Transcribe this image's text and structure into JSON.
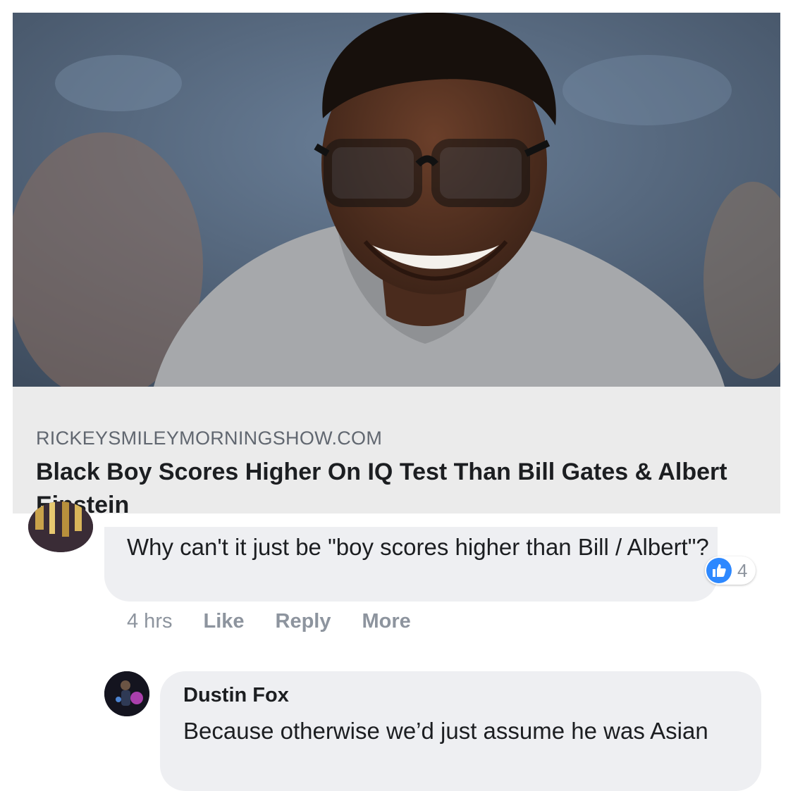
{
  "link_preview": {
    "image_icon": "photo-of-smiling-student-with-glasses",
    "domain": "RICKEYSMILEYMORNINGSHOW.COM",
    "title": "Black Boy Scores Higher On IQ Test Than Bill Gates & Albert Einstein"
  },
  "comment": {
    "avatar_icon": "user-avatar",
    "text": "Why can't it just be \"boy scores higher than Bill / Albert\"?",
    "like_icon": "thumbs-up-icon",
    "like_count": "4",
    "actions": {
      "time": "4 hrs",
      "like": "Like",
      "reply": "Reply",
      "more": "More"
    }
  },
  "reply": {
    "avatar_icon": "user-avatar",
    "author": "Dustin Fox",
    "text": "Because otherwise we’d just assume he was Asian"
  },
  "colors": {
    "bubble_background": "#eeeff2",
    "link_meta_background": "#ebebeb",
    "like_blue": "#2d88ff",
    "secondary_text": "#8d949e",
    "primary_text": "#1c1e21"
  }
}
